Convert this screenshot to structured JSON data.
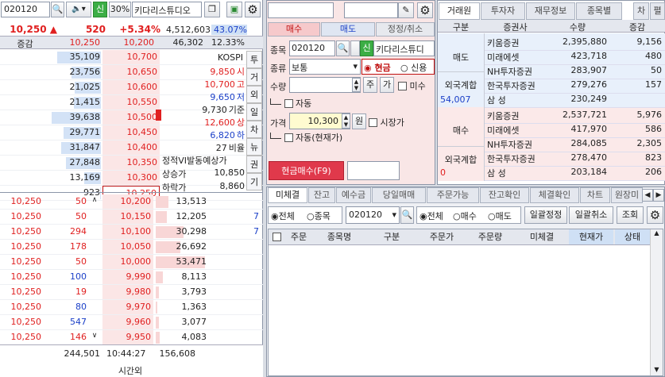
{
  "left": {
    "code": "020120",
    "pct_btn": "30%",
    "name": "키다리스튜디오",
    "price": "10,250",
    "arrow": "▲",
    "change": "520",
    "rate": "+5.34%",
    "volume": "4,512,603",
    "vol_rate": "43.07%",
    "header": {
      "label": "증감",
      "ask": "10,250",
      "bid": "10,200",
      "vol": "46,302",
      "vrate": "12.33%"
    },
    "asks": [
      {
        "qty": "35,109",
        "price": "10,700"
      },
      {
        "qty": "23,756",
        "price": "10,650"
      },
      {
        "qty": "21,025",
        "price": "10,600"
      },
      {
        "qty": "21,415",
        "price": "10,550"
      },
      {
        "qty": "39,638",
        "price": "10,500"
      },
      {
        "qty": "29,771",
        "price": "10,450"
      },
      {
        "qty": "31,847",
        "price": "10,400"
      },
      {
        "qty": "27,848",
        "price": "10,350"
      },
      {
        "qty": "13,169",
        "price": "10,300"
      },
      {
        "qty": "923",
        "price": "10,250"
      }
    ],
    "info": [
      {
        "v": "KOSPI",
        "l": ""
      },
      {
        "v": "9,850",
        "l": "시"
      },
      {
        "v": "10,700",
        "l": "고"
      },
      {
        "v": "9,650",
        "l": "저"
      },
      {
        "v": "9,730",
        "l": "기준"
      },
      {
        "v": "12,600",
        "l": "상"
      },
      {
        "v": "6,820",
        "l": "하"
      },
      {
        "v": "27",
        "l": "비율"
      }
    ],
    "info2": [
      {
        "l": "정적VI발동예상가",
        "v": ""
      },
      {
        "l": "상승가",
        "v": "10,850"
      },
      {
        "l": "하락가",
        "v": "8,860"
      }
    ],
    "side_tabs": [
      "투",
      "거",
      "외",
      "일",
      "차",
      "뉴",
      "권",
      "기"
    ],
    "trades": [
      {
        "p": "10,250",
        "q": "50"
      },
      {
        "p": "10,250",
        "q": "50"
      },
      {
        "p": "10,250",
        "q": "294"
      },
      {
        "p": "10,250",
        "q": "178"
      },
      {
        "p": "10,250",
        "q": "50"
      },
      {
        "p": "10,250",
        "q": "100"
      },
      {
        "p": "10,250",
        "q": "19"
      },
      {
        "p": "10,250",
        "q": "80"
      },
      {
        "p": "10,250",
        "q": "547"
      },
      {
        "p": "10,250",
        "q": "146"
      }
    ],
    "bids": [
      {
        "price": "10,200",
        "qty": "13,513",
        "m": ""
      },
      {
        "price": "10,150",
        "qty": "12,205",
        "m": "7"
      },
      {
        "price": "10,100",
        "qty": "30,298",
        "m": "7"
      },
      {
        "price": "10,050",
        "qty": "26,692",
        "m": ""
      },
      {
        "price": "10,000",
        "qty": "53,471",
        "m": ""
      },
      {
        "price": "9,990",
        "qty": "8,113",
        "m": ""
      },
      {
        "price": "9,980",
        "qty": "3,793",
        "m": ""
      },
      {
        "price": "9,970",
        "qty": "1,363",
        "m": ""
      },
      {
        "price": "9,960",
        "qty": "3,077",
        "m": ""
      },
      {
        "price": "9,950",
        "qty": "4,083",
        "m": ""
      }
    ],
    "footer": {
      "ask_total": "244,501",
      "time": "10:44:27",
      "bid_total": "156,608",
      "after": "시간외"
    }
  },
  "order": {
    "tabs": [
      "매수",
      "매도",
      "정정/취소"
    ],
    "labels": {
      "code": "종목",
      "type": "종류",
      "qty": "수량",
      "price": "가격"
    },
    "code": "020120",
    "sin": "신",
    "name": "키다리스튜디",
    "type": "보통",
    "cash": "현금",
    "credit": "신용",
    "ju": "주",
    "ga": "가",
    "misu": "미수",
    "auto": "자동",
    "price_val": "10,300",
    "won": "원",
    "market": "시장가",
    "auto2": "자동(현재가)",
    "submit": "현금매수(F9)"
  },
  "broker": {
    "tabs": [
      "거래원",
      "투자자",
      "재무정보",
      "종목별",
      "차",
      "펼"
    ],
    "head": [
      "구분",
      "증권사",
      "수량",
      "증감"
    ],
    "sell_label": "매도",
    "buy_label": "매수",
    "foreign": "외국계합",
    "sell_foreign": "54,007",
    "buy_foreign": "0",
    "sell": [
      {
        "n": "키움증권",
        "q": "2,395,880",
        "d": "9,156"
      },
      {
        "n": "미래에셋",
        "q": "423,718",
        "d": "480"
      },
      {
        "n": "NH투자증권",
        "q": "283,907",
        "d": "50"
      },
      {
        "n": "한국투자증권",
        "q": "279,276",
        "d": "157"
      },
      {
        "n": "삼  성",
        "q": "230,249",
        "d": ""
      }
    ],
    "buy": [
      {
        "n": "키움증권",
        "q": "2,537,721",
        "d": "5,976"
      },
      {
        "n": "미래에셋",
        "q": "417,970",
        "d": "586"
      },
      {
        "n": "NH투자증권",
        "q": "284,085",
        "d": "2,305"
      },
      {
        "n": "한국투자증권",
        "q": "278,470",
        "d": "823"
      },
      {
        "n": "삼  성",
        "q": "203,184",
        "d": "206"
      }
    ]
  },
  "orders": {
    "tabs": [
      "미체결",
      "잔고",
      "예수금",
      "당일매매",
      "주문가능",
      "잔고확인",
      "체결확인",
      "차트",
      "원장미"
    ],
    "all": "전체",
    "stock": "종목",
    "code": "020120",
    "all2": "전체",
    "buy": "매수",
    "sell": "매도",
    "b1": "일괄정정",
    "b2": "일괄취소",
    "b3": "조회",
    "cols": [
      "주문",
      "종목명",
      "구분",
      "주문가",
      "주문량",
      "미체결",
      "현재가",
      "상태"
    ]
  }
}
